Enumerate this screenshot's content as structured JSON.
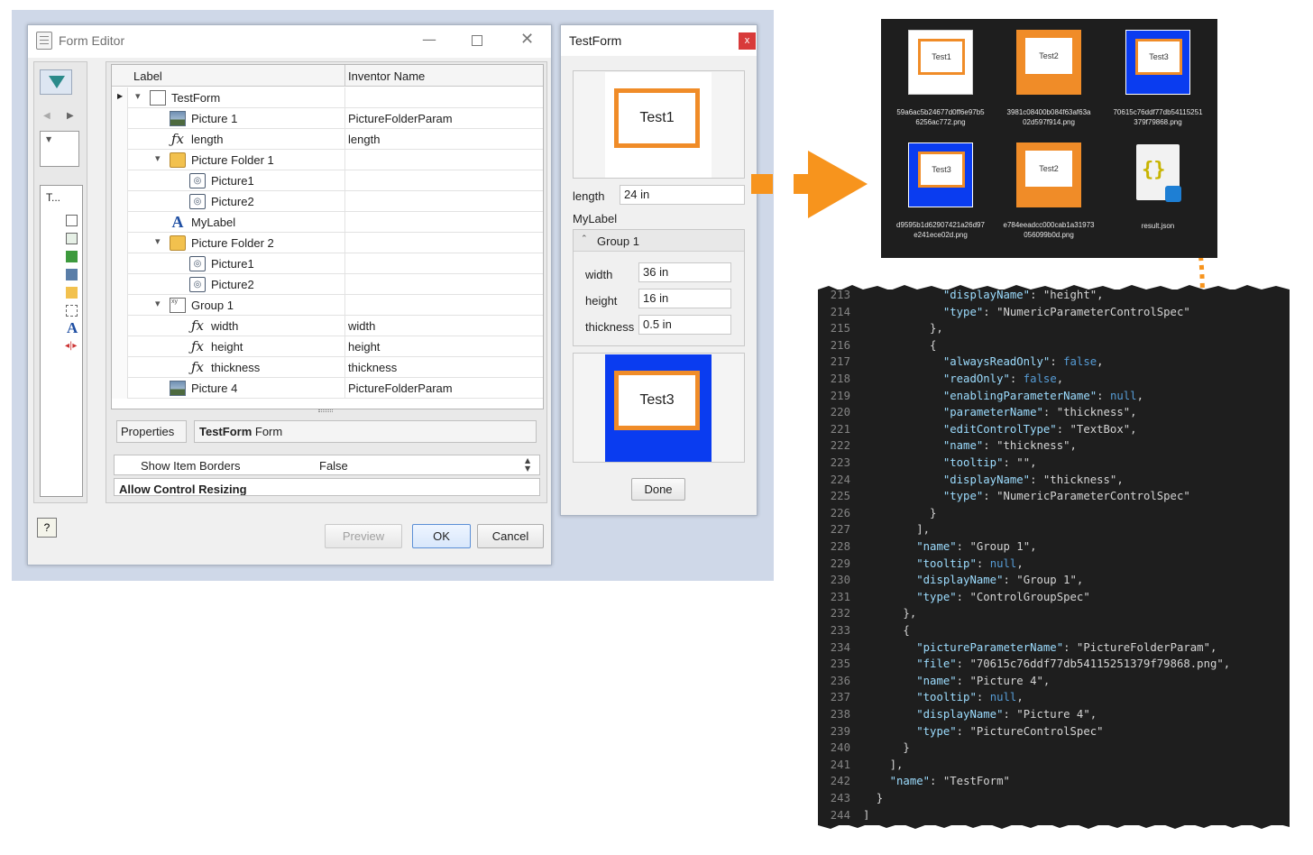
{
  "form_editor": {
    "title": "Form Editor",
    "toolbox_text": "T...",
    "columns": {
      "label": "Label",
      "inventor_name": "Inventor Name"
    },
    "tree": [
      {
        "label": "TestForm",
        "inventor": "",
        "icon": "form-icon"
      },
      {
        "label": "Picture 1",
        "inventor": "PictureFolderParam",
        "icon": "picture-icon"
      },
      {
        "label": "length",
        "inventor": "length",
        "icon": "function-icon"
      },
      {
        "label": "Picture Folder 1",
        "inventor": "",
        "icon": "picture-folder-icon"
      },
      {
        "label": "Picture1",
        "inventor": "",
        "icon": "camera-icon"
      },
      {
        "label": "Picture2",
        "inventor": "",
        "icon": "camera-icon"
      },
      {
        "label": "MyLabel",
        "inventor": "",
        "icon": "label-icon"
      },
      {
        "label": "Picture Folder 2",
        "inventor": "",
        "icon": "picture-folder-icon"
      },
      {
        "label": "Picture1",
        "inventor": "",
        "icon": "camera-icon"
      },
      {
        "label": "Picture2",
        "inventor": "",
        "icon": "camera-icon"
      },
      {
        "label": "Group 1",
        "inventor": "",
        "icon": "group-icon"
      },
      {
        "label": "width",
        "inventor": "width",
        "icon": "function-icon"
      },
      {
        "label": "height",
        "inventor": "height",
        "icon": "function-icon"
      },
      {
        "label": "thickness",
        "inventor": "thickness",
        "icon": "function-icon"
      },
      {
        "label": "Picture 4",
        "inventor": "PictureFolderParam",
        "icon": "picture-icon"
      }
    ],
    "properties_tab": "Properties",
    "selected_bold": "TestForm",
    "selected_rest": " Form",
    "show_item_borders_label": "Show Item Borders",
    "show_item_borders_value": "False",
    "allow_resizing_label": "Allow Control Resizing",
    "buttons": {
      "preview": "Preview",
      "ok": "OK",
      "cancel": "Cancel"
    }
  },
  "test_form": {
    "title": "TestForm",
    "close": "x",
    "image1_text": "Test1",
    "length_label": "length",
    "length_value": "24 in",
    "mylabel": "MyLabel",
    "group_title": "Group 1",
    "width_label": "width",
    "width_value": "36 in",
    "height_label": "height",
    "height_value": "16 in",
    "thickness_label": "thickness",
    "thickness_value": "0.5 in",
    "image2_text": "Test3",
    "done": "Done"
  },
  "viewer": {
    "files": [
      {
        "thumb": "Test1",
        "name1": "59a6ac5b24677d0ff6e97b5",
        "name2": "6256ac772.png",
        "style": "white"
      },
      {
        "thumb": "Test2",
        "name1": "3981c08400b084f63af63a",
        "name2": "02d597f914.png",
        "style": "orange"
      },
      {
        "thumb": "Test3",
        "name1": "70615c76ddf77db54115251",
        "name2": "379f79868.png",
        "style": "blue"
      },
      {
        "thumb": "Test3",
        "name1": "d9595b1d62907421a26d97",
        "name2": "e241ece02d.png",
        "style": "blue"
      },
      {
        "thumb": "Test2",
        "name1": "e784eeadcc000cab1a31973",
        "name2": "056099b0d.png",
        "style": "orange"
      },
      {
        "thumb": "",
        "name1": "result.json",
        "name2": "",
        "style": "json"
      }
    ]
  },
  "colors": {
    "accent_orange": "#f08c28",
    "blue_fill": "#0a3cf0",
    "code_bg": "#1e1e1e"
  },
  "code": [
    {
      "n": "213",
      "t": "            \"displayName\": \"height\","
    },
    {
      "n": "214",
      "t": "            \"type\": \"NumericParameterControlSpec\""
    },
    {
      "n": "215",
      "t": "          },"
    },
    {
      "n": "216",
      "t": "          {"
    },
    {
      "n": "217",
      "t": "            \"alwaysReadOnly\": false,"
    },
    {
      "n": "218",
      "t": "            \"readOnly\": false,"
    },
    {
      "n": "219",
      "t": "            \"enablingParameterName\": null,"
    },
    {
      "n": "220",
      "t": "            \"parameterName\": \"thickness\","
    },
    {
      "n": "221",
      "t": "            \"editControlType\": \"TextBox\","
    },
    {
      "n": "222",
      "t": "            \"name\": \"thickness\","
    },
    {
      "n": "223",
      "t": "            \"tooltip\": \"\","
    },
    {
      "n": "224",
      "t": "            \"displayName\": \"thickness\","
    },
    {
      "n": "225",
      "t": "            \"type\": \"NumericParameterControlSpec\""
    },
    {
      "n": "226",
      "t": "          }"
    },
    {
      "n": "227",
      "t": "        ],"
    },
    {
      "n": "228",
      "t": "        \"name\": \"Group 1\","
    },
    {
      "n": "229",
      "t": "        \"tooltip\": null,"
    },
    {
      "n": "230",
      "t": "        \"displayName\": \"Group 1\","
    },
    {
      "n": "231",
      "t": "        \"type\": \"ControlGroupSpec\""
    },
    {
      "n": "232",
      "t": "      },"
    },
    {
      "n": "233",
      "t": "      {"
    },
    {
      "n": "234",
      "t": "        \"pictureParameterName\": \"PictureFolderParam\","
    },
    {
      "n": "235",
      "t": "        \"file\": \"70615c76ddf77db54115251379f79868.png\","
    },
    {
      "n": "236",
      "t": "        \"name\": \"Picture 4\","
    },
    {
      "n": "237",
      "t": "        \"tooltip\": null,"
    },
    {
      "n": "238",
      "t": "        \"displayName\": \"Picture 4\","
    },
    {
      "n": "239",
      "t": "        \"type\": \"PictureControlSpec\""
    },
    {
      "n": "240",
      "t": "      }"
    },
    {
      "n": "241",
      "t": "    ],"
    },
    {
      "n": "242",
      "t": "    \"name\": \"TestForm\""
    },
    {
      "n": "243",
      "t": "  }"
    },
    {
      "n": "244",
      "t": "]"
    }
  ]
}
